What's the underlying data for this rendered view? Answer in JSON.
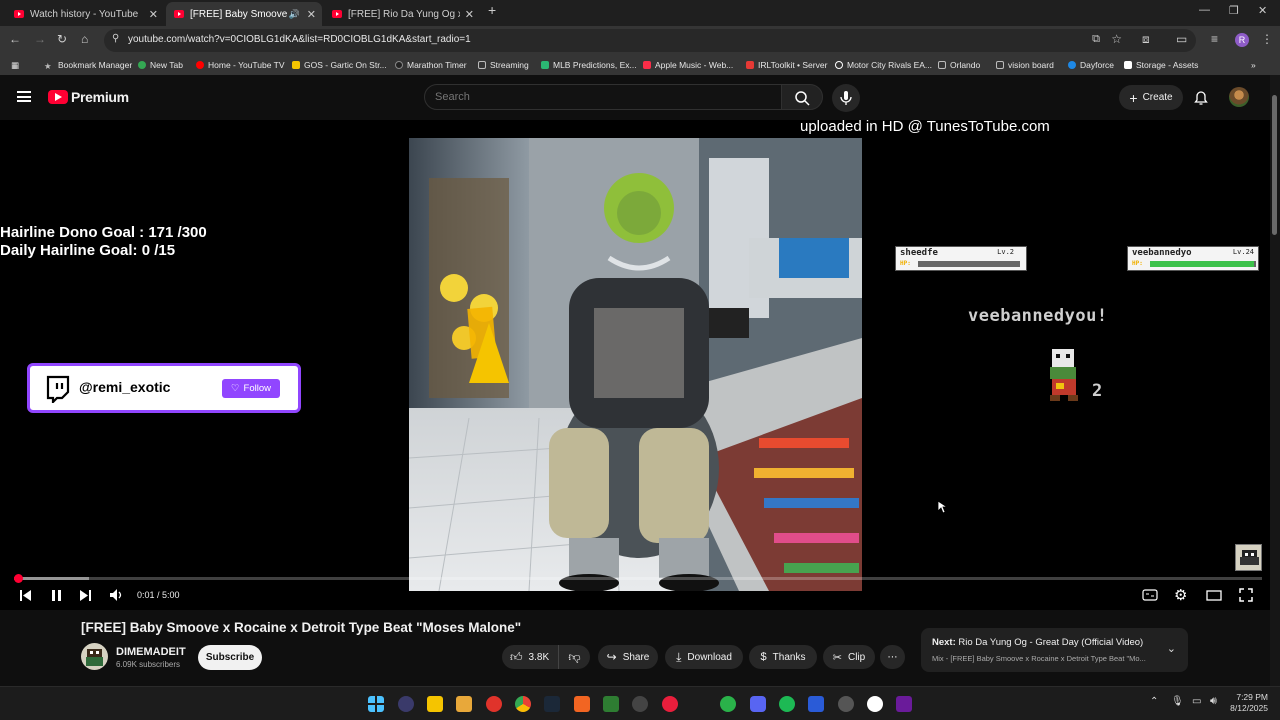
{
  "browser": {
    "tabs": [
      {
        "title": "Watch history - YouTube",
        "active": false
      },
      {
        "title": "[FREE] Baby Smoove x Roca",
        "active": true
      },
      {
        "title": "[FREE] Rio Da Yung Og x Flint",
        "active": false
      }
    ],
    "url": "youtube.com/watch?v=0CIOBLG1dKA&list=RD0CIOBLG1dKA&start_radio=1",
    "profile_initial": "R",
    "bookmarks": [
      {
        "label": "Bookmark Manager",
        "color": "#bdbdbd"
      },
      {
        "label": "New Tab",
        "color": "#34a853"
      },
      {
        "label": "Home - YouTube TV",
        "color": "#ff0000"
      },
      {
        "label": "GOS - Gartic On Str...",
        "color": "#f5c400"
      },
      {
        "label": "Marathon Timer",
        "color": "#222222"
      },
      {
        "label": "Streaming",
        "color": "#9e9e9e"
      },
      {
        "label": "MLB Predictions, Ex...",
        "color": "#2bb673"
      },
      {
        "label": "Apple Music - Web...",
        "color": "#fa2d48"
      },
      {
        "label": "IRLToolkit • Server",
        "color": "#e53935"
      },
      {
        "label": "Motor City Rivals EA...",
        "color": "#ffffff"
      },
      {
        "label": "Orlando",
        "color": "#9e9e9e"
      },
      {
        "label": "vision board",
        "color": "#9e9e9e"
      },
      {
        "label": "Dayforce",
        "color": "#1e88e5"
      },
      {
        "label": "Storage - Assets",
        "color": "#ffffff"
      }
    ]
  },
  "youtube": {
    "logo_text": "Premium",
    "search_placeholder": "Search",
    "create_label": "Create"
  },
  "video_overlay": {
    "watermark": "uploaded in HD @ TunesToTube.com",
    "goal_line_1": "Hairline Dono Goal : 171 /300",
    "goal_line_2": "Daily Hairline Goal: 0  /15",
    "twitch_handle": "@remi_exotic",
    "follow_label": "Follow",
    "player1_name": "sheedfe",
    "player1_level": "Lv.2",
    "player2_name": "veebannedyo",
    "player2_level": "Lv.24",
    "hp_label": "HP:",
    "battle_text": "veebannedyou!",
    "sprite_count": "2",
    "player1_hp_fraction": 0.0,
    "player2_hp_fraction": 0.98
  },
  "player": {
    "time": "0:01 / 5:00",
    "progress_fraction": 0.003,
    "buffered_fraction": 0.06
  },
  "video_info": {
    "title": "[FREE] Baby Smoove x Rocaine x Detroit Type Beat \"Moses Malone\"",
    "channel_name": "DIMEMADEIT",
    "subscribers": "6.09K subscribers",
    "subscribe_label": "Subscribe",
    "likes": "3.8K",
    "share_label": "Share",
    "download_label": "Download",
    "thanks_label": "Thanks",
    "clip_label": "Clip"
  },
  "up_next": {
    "prefix": "Next:",
    "title": "Rio Da Yung Og - Great Day (Official Video)",
    "subtitle": "Mix - [FREE] Baby Smoove x Rocaine x Detroit Type Beat \"Mo..."
  },
  "taskbar": {
    "time": "7:29 PM",
    "date": "8/12/2025"
  }
}
